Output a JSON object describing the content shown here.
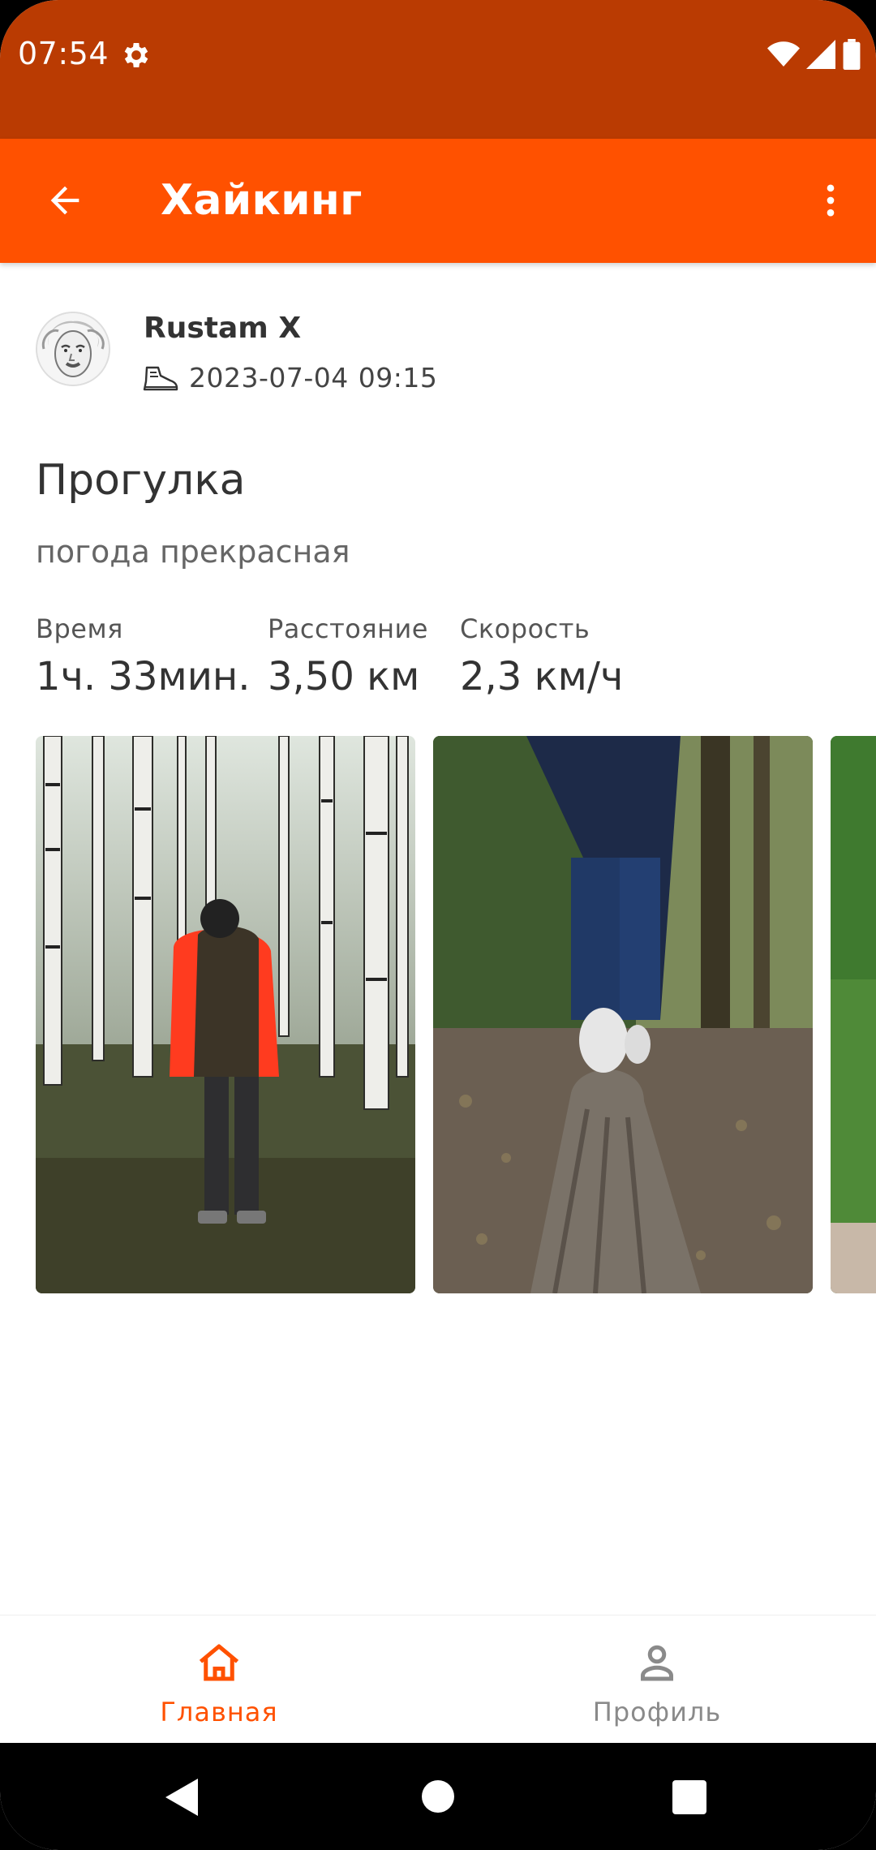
{
  "status_bar": {
    "time": "07:54",
    "background": "#BA3B02"
  },
  "app_bar": {
    "title": "Хайкинг",
    "background": "#FF5100"
  },
  "post": {
    "author": "Rustam X",
    "date": "2023-07-04",
    "time": "09:15",
    "title": "Прогулка",
    "description": "погода прекрасная",
    "stats": [
      {
        "label": "Время",
        "value": "1ч. 33мин."
      },
      {
        "label": "Расстояние",
        "value": "3,50 км"
      },
      {
        "label": "Скорость",
        "value": "2,3 км/ч"
      }
    ]
  },
  "bottom_nav": {
    "items": [
      {
        "label": "Главная",
        "icon": "home-icon",
        "active": true
      },
      {
        "label": "Профиль",
        "icon": "person-icon",
        "active": false
      }
    ],
    "active_color": "#FF5100",
    "inactive_color": "#8A8A8A"
  }
}
